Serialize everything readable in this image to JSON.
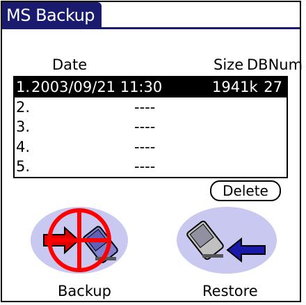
{
  "app": {
    "title": "MS Backup"
  },
  "columns": {
    "date": "Date",
    "size": "Size",
    "dbnum": "DBNum"
  },
  "rows": [
    {
      "num": "1.",
      "date": "2003/09/21 11:30",
      "size": "1941k",
      "db": "27",
      "selected": true
    },
    {
      "num": "2.",
      "placeholder": "----"
    },
    {
      "num": "3.",
      "placeholder": "----"
    },
    {
      "num": "4.",
      "placeholder": "----"
    },
    {
      "num": "5.",
      "placeholder": "----"
    }
  ],
  "buttons": {
    "delete": "Delete",
    "backup": "Backup",
    "restore": "Restore"
  },
  "icons": {
    "backup": "backup-disabled-icon",
    "restore": "restore-icon"
  },
  "colors": {
    "title_bg": "#1a1a6e",
    "icon_bg": "#c8c8f0",
    "prohibit_red": "#ff0000",
    "arrow_red": "#e00000",
    "arrow_blue": "#1a1aa8"
  }
}
